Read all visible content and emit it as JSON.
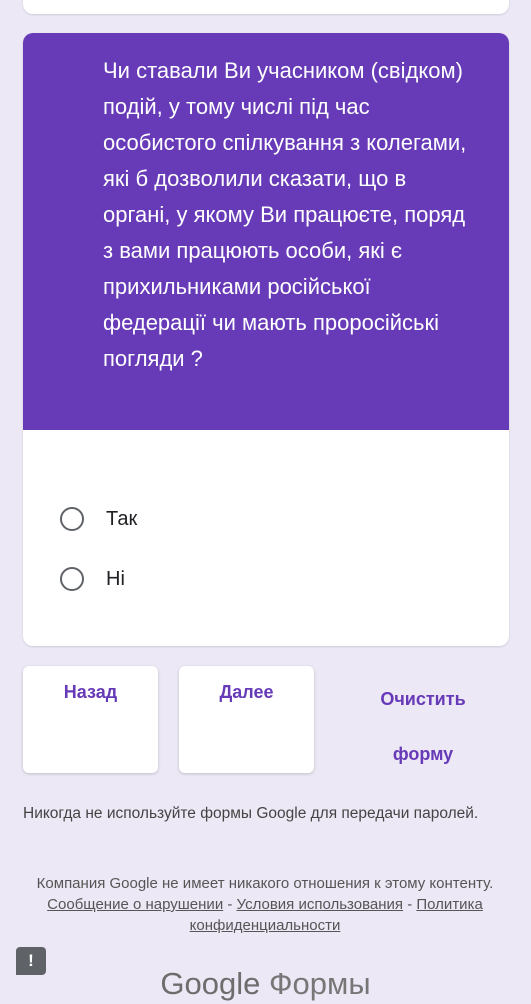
{
  "question": {
    "text": "Чи ставали Ви учасником (свідком) подій, у тому числі під час особистого спілкування з колегами, які б дозволили сказати, що в органі, у якому Ви працюєте, поряд з вами працюють особи, які є прихильниками російської федерації чи мають проросійські погляди ?",
    "options": [
      {
        "label": "Так"
      },
      {
        "label": "Ні"
      }
    ]
  },
  "navigation": {
    "back_label": "Назад",
    "next_label": "Далее",
    "clear_label": "Очистить форму"
  },
  "footer": {
    "password_note": "Никогда не используйте формы Google для передачи паролей.",
    "disclaimer_text": "Компания Google не имеет никакого отношения к этому контенту.",
    "report_link": "Сообщение о нарушении",
    "separator": "-",
    "terms_link": "Условия использования",
    "privacy_link": "Политика конфиденциальности",
    "report_icon_glyph": "!",
    "report_icon_name": "report-icon"
  },
  "brand": {
    "google": "Google",
    "product": "Формы"
  },
  "colors": {
    "accent": "#673ab7",
    "background": "#ece8f5"
  }
}
